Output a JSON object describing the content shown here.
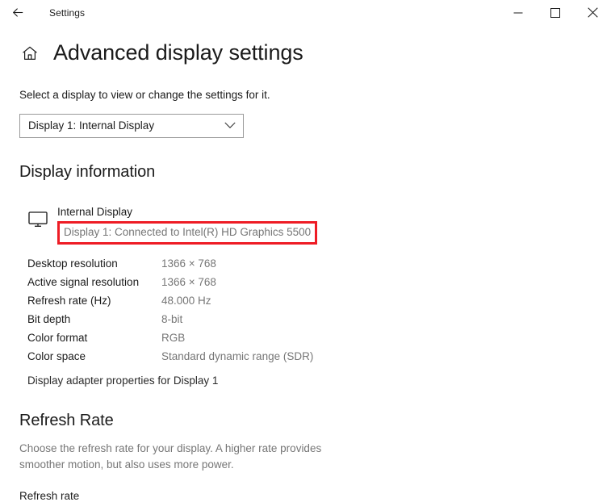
{
  "titlebar": {
    "back_label": "Back",
    "title": "Settings",
    "minimize_label": "Minimize",
    "maximize_label": "Maximize",
    "close_label": "Close"
  },
  "header": {
    "home_label": "Home",
    "title": "Advanced display settings"
  },
  "display_select": {
    "intro": "Select a display to view or change the settings for it.",
    "selected": "Display 1: Internal Display",
    "options": [
      "Display 1: Internal Display"
    ]
  },
  "display_information": {
    "heading": "Display information",
    "display_name": "Internal Display",
    "connection": "Display 1: Connected to Intel(R) HD Graphics 5500",
    "highlight_color": "#ee1c25",
    "rows": [
      {
        "label": "Desktop resolution",
        "value": "1366 × 768"
      },
      {
        "label": "Active signal resolution",
        "value": "1366 × 768"
      },
      {
        "label": "Refresh rate (Hz)",
        "value": "48.000 Hz"
      },
      {
        "label": "Bit depth",
        "value": "8-bit"
      },
      {
        "label": "Color format",
        "value": "RGB"
      },
      {
        "label": "Color space",
        "value": "Standard dynamic range (SDR)"
      }
    ],
    "adapter_link": "Display adapter properties for Display 1"
  },
  "refresh_rate": {
    "heading": "Refresh Rate",
    "description": "Choose the refresh rate for your display. A higher rate provides smoother motion, but also uses more power.",
    "field_label": "Refresh rate"
  }
}
